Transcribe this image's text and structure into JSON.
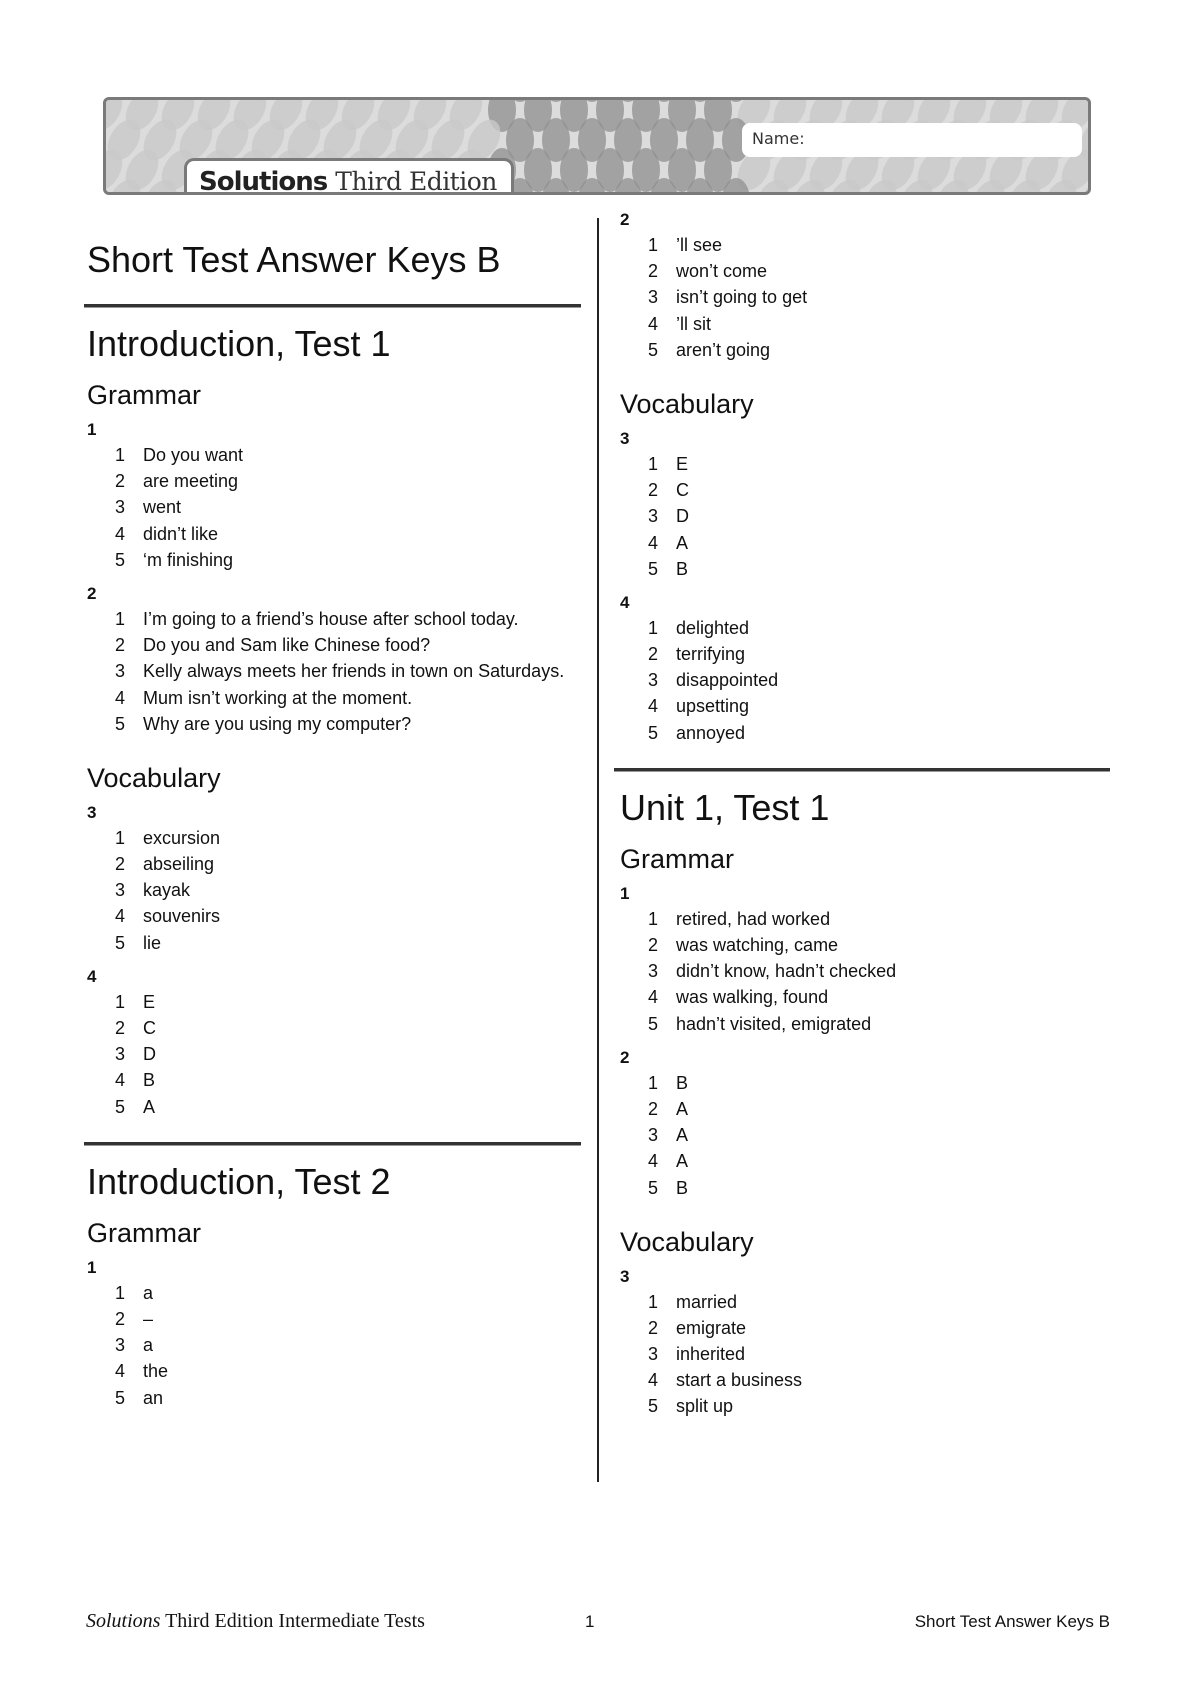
{
  "header": {
    "brand_bold": "Solutions",
    "brand_rest": "Third Edition",
    "name_label": "Name:",
    "colors": {
      "border": "#7a7a7a",
      "pattern_light": "#c9c9c9",
      "pattern_dark": "#8f8f8f"
    }
  },
  "document": {
    "title": "Short Test Answer Keys B"
  },
  "left_column": {
    "tests": [
      {
        "title": "Introduction, Test 1",
        "sections": [
          {
            "title": "Grammar",
            "exercises": [
              {
                "number": "1",
                "items": [
                  {
                    "n": "1",
                    "text": "Do you want"
                  },
                  {
                    "n": "2",
                    "text": "are meeting"
                  },
                  {
                    "n": "3",
                    "text": "went"
                  },
                  {
                    "n": "4",
                    "text": "didn’t like"
                  },
                  {
                    "n": "5",
                    "text": "‘m finishing"
                  }
                ]
              },
              {
                "number": "2",
                "items": [
                  {
                    "n": "1",
                    "text": "I’m going to a friend’s house after school today."
                  },
                  {
                    "n": "2",
                    "text": "Do you and Sam like Chinese food?"
                  },
                  {
                    "n": "3",
                    "text": "Kelly always meets her friends in town on Saturdays."
                  },
                  {
                    "n": "4",
                    "text": "Mum isn’t working at the moment."
                  },
                  {
                    "n": "5",
                    "text": "Why are you using my computer?"
                  }
                ]
              }
            ]
          },
          {
            "title": "Vocabulary",
            "exercises": [
              {
                "number": "3",
                "items": [
                  {
                    "n": "1",
                    "text": "excursion"
                  },
                  {
                    "n": "2",
                    "text": "abseiling"
                  },
                  {
                    "n": "3",
                    "text": "kayak"
                  },
                  {
                    "n": "4",
                    "text": "souvenirs"
                  },
                  {
                    "n": "5",
                    "text": "lie"
                  }
                ]
              },
              {
                "number": "4",
                "items": [
                  {
                    "n": "1",
                    "text": "E"
                  },
                  {
                    "n": "2",
                    "text": "C"
                  },
                  {
                    "n": "3",
                    "text": "D"
                  },
                  {
                    "n": "4",
                    "text": "B"
                  },
                  {
                    "n": "5",
                    "text": "A"
                  }
                ]
              }
            ]
          }
        ]
      },
      {
        "title": "Introduction, Test 2",
        "sections": [
          {
            "title": "Grammar",
            "exercises": [
              {
                "number": "1",
                "items": [
                  {
                    "n": "1",
                    "text": "a"
                  },
                  {
                    "n": "2",
                    "text": "–"
                  },
                  {
                    "n": "3",
                    "text": "a"
                  },
                  {
                    "n": "4",
                    "text": "the"
                  },
                  {
                    "n": "5",
                    "text": "an"
                  }
                ]
              }
            ]
          }
        ]
      }
    ]
  },
  "right_column": {
    "continued_exercises": [
      {
        "number": "2",
        "items": [
          {
            "n": "1",
            "text": "’ll see"
          },
          {
            "n": "2",
            "text": "won’t come"
          },
          {
            "n": "3",
            "text": "isn’t going to get"
          },
          {
            "n": "4",
            "text": "’ll sit"
          },
          {
            "n": "5",
            "text": "aren’t going"
          }
        ]
      }
    ],
    "continued_sections": [
      {
        "title": "Vocabulary",
        "exercises": [
          {
            "number": "3",
            "items": [
              {
                "n": "1",
                "text": "E"
              },
              {
                "n": "2",
                "text": "C"
              },
              {
                "n": "3",
                "text": "D"
              },
              {
                "n": "4",
                "text": "A"
              },
              {
                "n": "5",
                "text": "B"
              }
            ]
          },
          {
            "number": "4",
            "items": [
              {
                "n": "1",
                "text": "delighted"
              },
              {
                "n": "2",
                "text": "terrifying"
              },
              {
                "n": "3",
                "text": "disappointed"
              },
              {
                "n": "4",
                "text": "upsetting"
              },
              {
                "n": "5",
                "text": "annoyed"
              }
            ]
          }
        ]
      }
    ],
    "tests": [
      {
        "title": "Unit 1, Test 1",
        "sections": [
          {
            "title": "Grammar",
            "exercises": [
              {
                "number": "1",
                "items": [
                  {
                    "n": "1",
                    "text": "retired, had worked"
                  },
                  {
                    "n": "2",
                    "text": "was watching, came"
                  },
                  {
                    "n": "3",
                    "text": "didn’t know, hadn’t checked"
                  },
                  {
                    "n": "4",
                    "text": "was walking, found"
                  },
                  {
                    "n": "5",
                    "text": "hadn’t visited, emigrated"
                  }
                ]
              },
              {
                "number": "2",
                "items": [
                  {
                    "n": "1",
                    "text": "B"
                  },
                  {
                    "n": "2",
                    "text": "A"
                  },
                  {
                    "n": "3",
                    "text": "A"
                  },
                  {
                    "n": "4",
                    "text": "A"
                  },
                  {
                    "n": "5",
                    "text": "B"
                  }
                ]
              }
            ]
          },
          {
            "title": "Vocabulary",
            "exercises": [
              {
                "number": "3",
                "items": [
                  {
                    "n": "1",
                    "text": "married"
                  },
                  {
                    "n": "2",
                    "text": "emigrate"
                  },
                  {
                    "n": "3",
                    "text": "inherited"
                  },
                  {
                    "n": "4",
                    "text": "start a business"
                  },
                  {
                    "n": "5",
                    "text": "split up"
                  }
                ]
              }
            ]
          }
        ]
      }
    ]
  },
  "footer": {
    "left_italic": "Solutions",
    "left_rest": " Third Edition Intermediate Tests",
    "page_number": "1",
    "right": "Short Test Answer Keys B"
  }
}
